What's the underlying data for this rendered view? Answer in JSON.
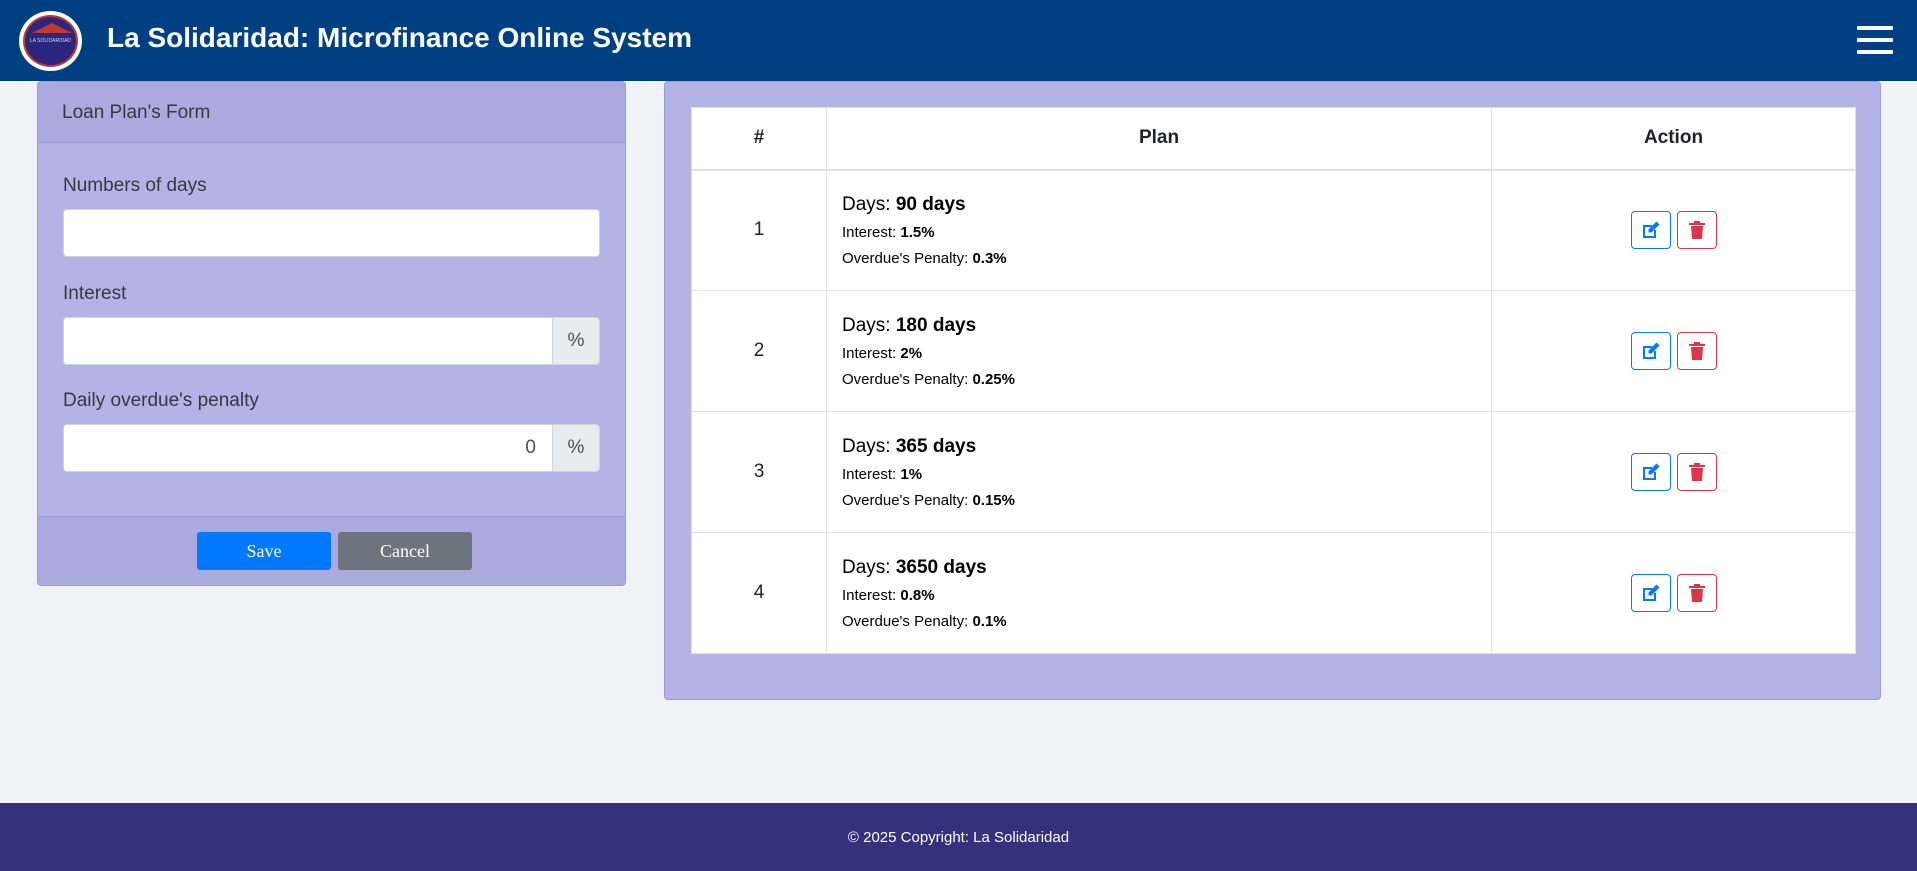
{
  "header": {
    "title": "La Solidaridad: Microfinance Online System",
    "logo_text": "LA SOLIDARIDAD"
  },
  "form": {
    "title": "Loan Plan's Form",
    "days_label": "Numbers of days",
    "days_value": "",
    "interest_label": "Interest",
    "interest_value": "",
    "interest_suffix": "%",
    "penalty_label": "Daily overdue's penalty",
    "penalty_value": "0",
    "penalty_suffix": "%",
    "save_label": "Save",
    "cancel_label": "Cancel"
  },
  "table": {
    "headers": [
      "#",
      "Plan",
      "Action"
    ],
    "days_prefix": "Days: ",
    "interest_prefix": "Interest: ",
    "penalty_prefix": "Overdue's Penalty: ",
    "rows": [
      {
        "num": "1",
        "days": "90 days",
        "interest": "1.5%",
        "penalty": "0.3%"
      },
      {
        "num": "2",
        "days": "180 days",
        "interest": "2%",
        "penalty": "0.25%"
      },
      {
        "num": "3",
        "days": "365 days",
        "interest": "1%",
        "penalty": "0.15%"
      },
      {
        "num": "4",
        "days": "3650 days",
        "interest": "0.8%",
        "penalty": "0.1%"
      }
    ]
  },
  "footer": {
    "copyright": "© 2025 Copyright: La Solidaridad"
  },
  "colors": {
    "header_bg": "#003f82",
    "card_bg": "#b3b3e6",
    "footer_bg": "#34317d",
    "primary": "#007bff",
    "danger": "#dc3545",
    "secondary": "#6c757d"
  }
}
